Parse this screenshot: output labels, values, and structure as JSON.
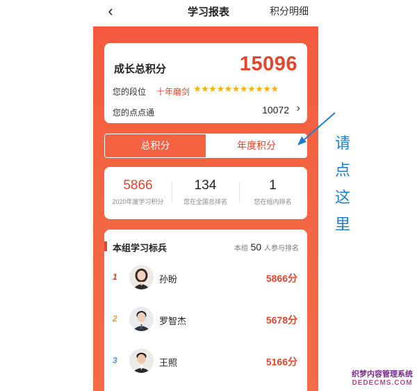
{
  "header": {
    "back_glyph": "‹",
    "title": "学习报表",
    "right_link": "积分明细"
  },
  "score_card": {
    "growth_label": "成长总积分",
    "growth_value": "15096",
    "rank_label": "您的段位",
    "rank_title": "十年磨剑",
    "stars": "★★★★★★★★★★★",
    "star_count": 11,
    "points_label": "您的点点通",
    "points_value": "10072",
    "points_chevron": "›"
  },
  "tabs": [
    {
      "label": "总积分",
      "active": false
    },
    {
      "label": "年度积分",
      "active": true
    }
  ],
  "stats": [
    {
      "value": "5866",
      "label": "2020年度学习积分"
    },
    {
      "value": "134",
      "label": "您在全国总排名"
    },
    {
      "value": "1",
      "label": "您在组内排名"
    }
  ],
  "leaderboard": {
    "title": "本组学习标兵",
    "count_prefix": "本组",
    "count_value": "50",
    "count_suffix": "人参与排名",
    "rows": [
      {
        "rank": "1",
        "name": "孙盼",
        "score": "5866分"
      },
      {
        "rank": "2",
        "name": "罗智杰",
        "score": "5678分"
      },
      {
        "rank": "3",
        "name": "王照",
        "score": "5166分"
      }
    ]
  },
  "annotation": {
    "chars": [
      "请",
      "点",
      "这",
      "里"
    ]
  },
  "watermark": {
    "line1": "织梦内容管理系统",
    "line2": "DEDECMS.COM"
  },
  "colors": {
    "accent": "#e4452e",
    "panel": "#f36442",
    "star": "#f5b400",
    "annotation": "#1f7fcc"
  }
}
